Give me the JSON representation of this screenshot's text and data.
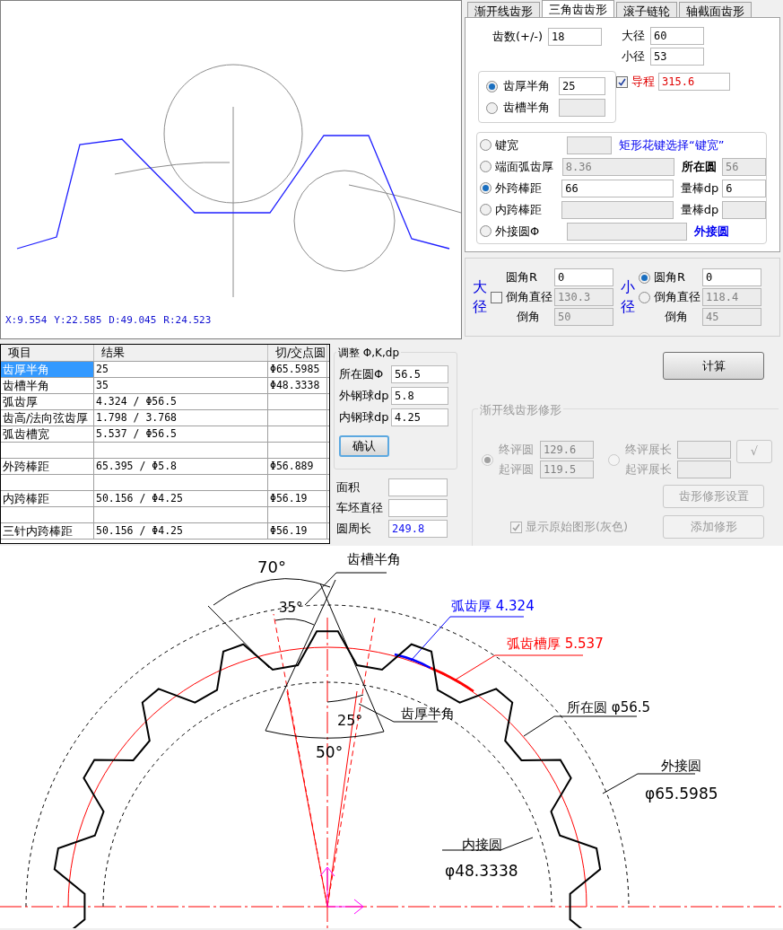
{
  "preview": {
    "readouts": [
      "X:9.554",
      "Y:22.585",
      "D:49.045",
      "R:24.523"
    ]
  },
  "tabs": [
    {
      "label": "渐开线齿形",
      "selected": false
    },
    {
      "label": "三角齿齿形",
      "selected": true
    },
    {
      "label": "滚子链轮",
      "selected": false
    },
    {
      "label": "轴截面齿形",
      "selected": false
    }
  ],
  "params": {
    "teeth": {
      "label": "齿数(+/-)",
      "value": "18"
    },
    "major": {
      "label": "大径",
      "value": "60"
    },
    "minor": {
      "label": "小径",
      "value": "53"
    }
  },
  "half_angle_options": [
    {
      "label": "齿厚半角",
      "value": "25",
      "selected": true
    },
    {
      "label": "齿槽半角",
      "selected": false
    }
  ],
  "lead": {
    "label": "导程",
    "value": "315.6",
    "checked": true
  },
  "measure_options": [
    {
      "label": "键宽",
      "selected": false,
      "note": "矩形花键选择“键宽”",
      "note_bold": false
    },
    {
      "label": "端面弧齿厚",
      "value": "8.36",
      "selected": false,
      "side_label": "所在圆",
      "side_value": "56",
      "side_bold": true
    },
    {
      "label": "外跨棒距",
      "value": "66",
      "selected": true,
      "side_label": "量棒dp",
      "side_value": "6",
      "side_bold": false
    },
    {
      "label": "内跨棒距",
      "selected": false,
      "side_label": "量棒dp",
      "side_bold": false
    },
    {
      "label": "外接圆Φ",
      "selected": false,
      "note": "外接圆",
      "note_bold": true
    }
  ],
  "fillets": [
    {
      "kind": "checkbox",
      "title": "大径",
      "radius": {
        "label": "圆角R",
        "value": "0"
      },
      "chamfer": {
        "label": "倒角直径",
        "value": "130.3"
      },
      "angle": {
        "label": "倒角",
        "value": "50"
      },
      "chamfer_checked": false
    },
    {
      "kind": "radio",
      "title": "小径",
      "radius": {
        "label": "圆角R",
        "value": "0"
      },
      "chamfer": {
        "label": "倒角直径",
        "value": "118.4"
      },
      "angle": {
        "label": "倒角",
        "value": "45"
      },
      "radius_selected": true,
      "chamfer_selected": false
    }
  ],
  "results_table": {
    "columns": [
      "项目",
      "结果",
      "切/交点圆"
    ],
    "rows": [
      {
        "cells": [
          "齿厚半角",
          "25",
          "Φ65.5985"
        ],
        "selected": true
      },
      {
        "cells": [
          "齿槽半角",
          "35",
          "Φ48.3338"
        ],
        "selected": false
      },
      {
        "cells": [
          "弧齿厚",
          "4.324 / Φ56.5"
        ],
        "selected": false
      },
      {
        "cells": [
          "齿高/法向弦齿厚",
          "1.798 / 3.768"
        ],
        "selected": false
      },
      {
        "cells": [
          "弧齿槽宽",
          "5.537 / Φ56.5"
        ],
        "selected": false
      },
      {
        "selected": false
      },
      {
        "cells": [
          "外跨棒距",
          "65.395 / Φ5.8",
          "Φ56.889"
        ],
        "selected": false
      },
      {
        "selected": false
      },
      {
        "cells": [
          "内跨棒距",
          "50.156 / Φ4.25",
          "Φ56.19"
        ],
        "selected": false
      },
      {
        "selected": false
      },
      {
        "cells": [
          "三针内跨棒距",
          "50.156 / Φ4.25",
          "Φ56.19"
        ],
        "selected": false
      }
    ]
  },
  "adjust": {
    "title": "调整 Φ,K,dp",
    "fields": [
      {
        "label": "所在圆Φ",
        "value": "56.5"
      },
      {
        "label": "外钢球dp",
        "value": "5.8"
      },
      {
        "label": "内钢球dp",
        "value": "4.25"
      }
    ],
    "button": "确认"
  },
  "outputs": [
    {
      "label": "面积"
    },
    {
      "label": "车坯直径"
    },
    {
      "label": "圆周长",
      "value": "249.8"
    }
  ],
  "calculate_button": "计算",
  "modification": {
    "title": "渐开线齿形修形",
    "disabled": true,
    "circle_selected": true,
    "length_selected": false,
    "end_circle": {
      "label": "终评圆",
      "value": "129.6"
    },
    "start_circle": {
      "label": "起评圆",
      "value": "119.5"
    },
    "end_length": {
      "label": "终评展长"
    },
    "start_length": {
      "label": "起评展长"
    },
    "tick_button": "√",
    "settings_button": "齿形修形设置",
    "add_button": "添加修形",
    "show_original": {
      "label": "显示原始图形(灰色)",
      "checked": true
    }
  },
  "drawing": {
    "labels": [
      {
        "text": "70°",
        "color": "#000000"
      },
      {
        "text": "35°",
        "color": "#000000"
      },
      {
        "text": "齿槽半角",
        "color": "#000000"
      },
      {
        "text": "弧齿厚 4.324",
        "color": "#0000ff"
      },
      {
        "text": "弧齿槽厚 5.537",
        "color": "#ff0000"
      },
      {
        "text": "25°",
        "color": "#000000"
      },
      {
        "text": "齿厚半角",
        "color": "#000000"
      },
      {
        "text": "50°",
        "color": "#000000"
      },
      {
        "text": "所在圆 φ56.5",
        "color": "#000000"
      },
      {
        "text": "外接圆",
        "color": "#000000"
      },
      {
        "text": "φ65.5985",
        "color": "#000000"
      },
      {
        "text": "内接圆",
        "color": "#000000"
      },
      {
        "text": "φ48.3338",
        "color": "#000000"
      }
    ]
  }
}
